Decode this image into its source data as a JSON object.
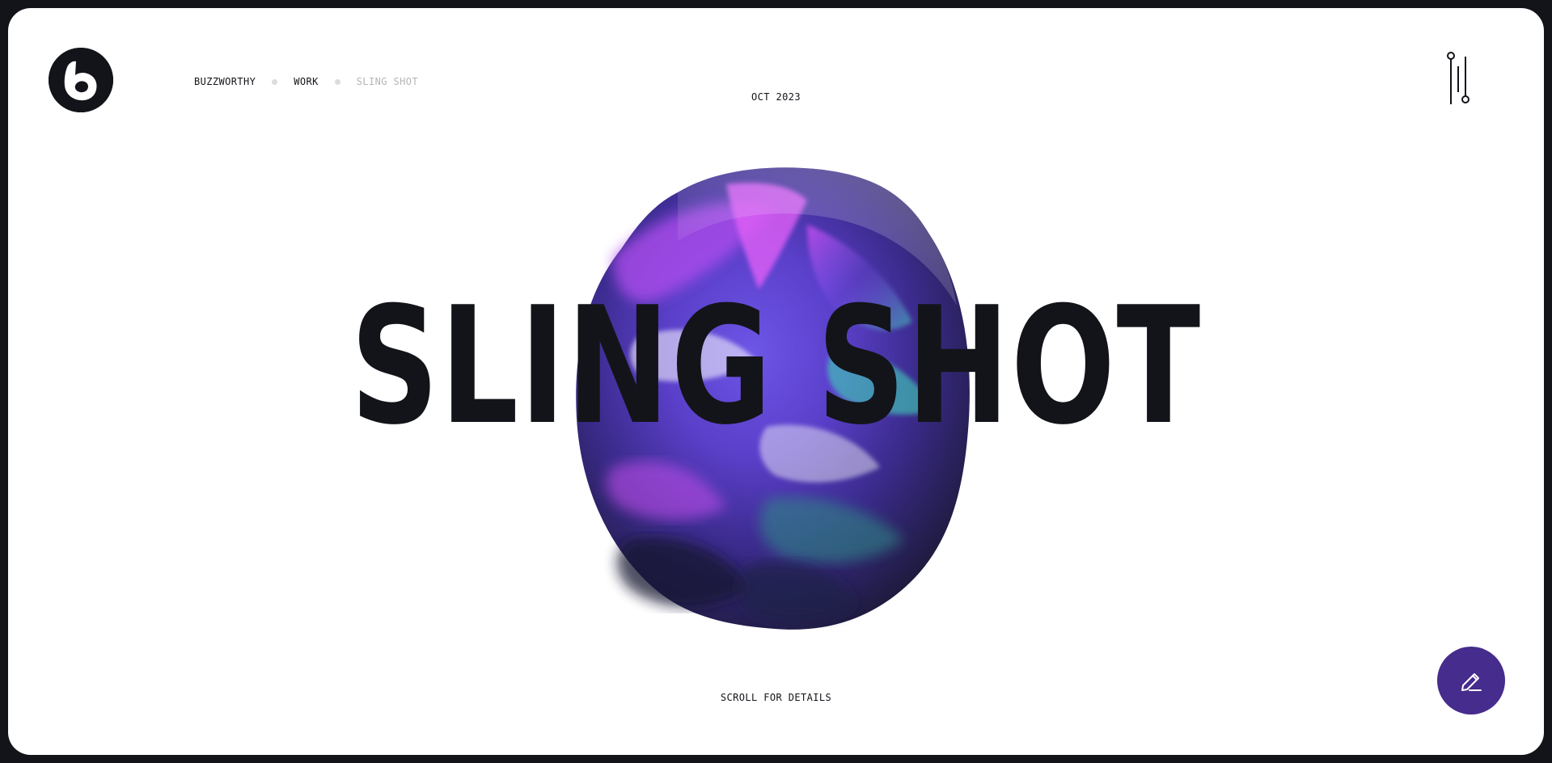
{
  "header": {
    "breadcrumb": [
      {
        "label": "BUZZWORTHY"
      },
      {
        "label": "WORK"
      },
      {
        "label": "SLING SHOT"
      }
    ],
    "date": "OCT 2023",
    "logo_icon": "buzzworthy-b-logo-icon",
    "menu_icon": "sliders-menu-icon"
  },
  "hero": {
    "title": "SLING SHOT",
    "scroll_hint": "SCROLL FOR DETAILS",
    "visual": "iridescent-blob-3d-render"
  },
  "fab": {
    "icon": "pencil-icon"
  },
  "colors": {
    "page_background": "#131419",
    "frame_background": "#ffffff",
    "text": "#131419",
    "muted_text": "#b5b5b8",
    "fab": "#462c8c",
    "blob_primary": "#7a3fe0",
    "blob_accent": "#c23ff2",
    "blob_teal": "#3fd3b8"
  }
}
